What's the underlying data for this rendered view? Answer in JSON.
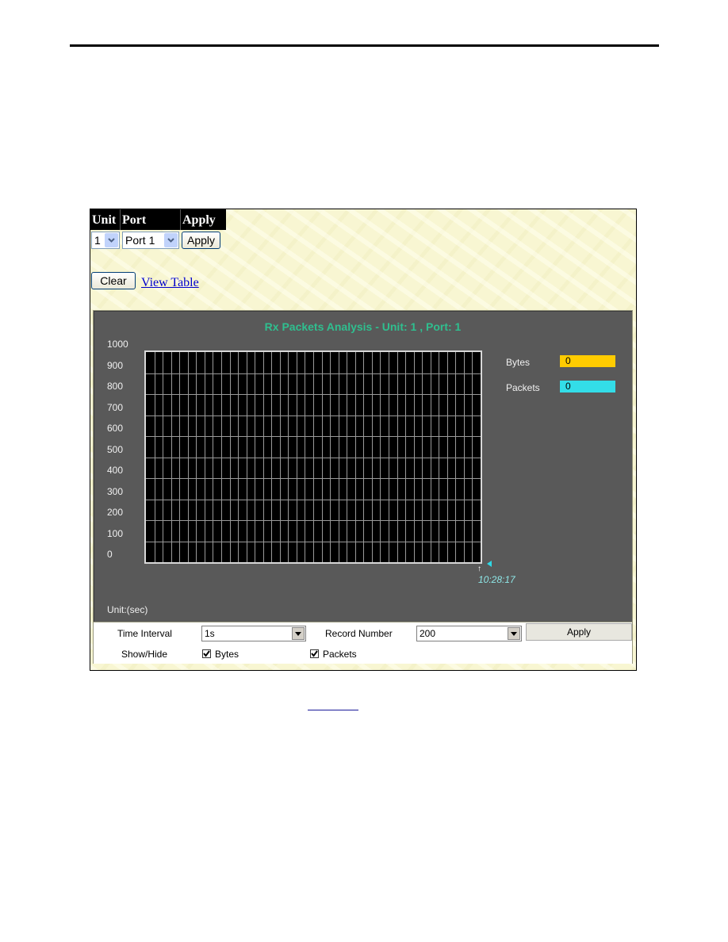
{
  "header_table": {
    "columns": [
      "Unit",
      "Port",
      "Apply"
    ],
    "unit_select": {
      "value": "1"
    },
    "port_select": {
      "value": "Port 1"
    },
    "apply_label": "Apply"
  },
  "actions": {
    "clear_label": "Clear",
    "view_table_label": "View Table"
  },
  "chart_data": {
    "type": "line",
    "title": "Rx Packets Analysis - Unit: 1 , Port: 1",
    "xlabel": "Unit:(sec)",
    "ylabel": "",
    "ylim": [
      0,
      1000
    ],
    "y_ticks": [
      1000,
      900,
      800,
      700,
      600,
      500,
      400,
      300,
      200,
      100,
      0
    ],
    "x_ticks": [
      "10:28:17"
    ],
    "grid": true,
    "legend_position": "right",
    "series": [
      {
        "name": "Bytes",
        "color": "#ffcc00",
        "current_value": "0",
        "values": []
      },
      {
        "name": "Packets",
        "color": "#33dde8",
        "current_value": "0",
        "values": []
      }
    ]
  },
  "controls": {
    "time_interval_label": "Time Interval",
    "time_interval_value": "1s",
    "record_number_label": "Record Number",
    "record_number_value": "200",
    "apply_label": "Apply",
    "show_hide_label": "Show/Hide",
    "show_bytes_label": "Bytes",
    "show_bytes_checked": true,
    "show_packets_label": "Packets",
    "show_packets_checked": true
  },
  "colors": {
    "title": "#2fbf8f",
    "panel": "#595959",
    "plot": "#000000",
    "link": "#0000cc"
  }
}
